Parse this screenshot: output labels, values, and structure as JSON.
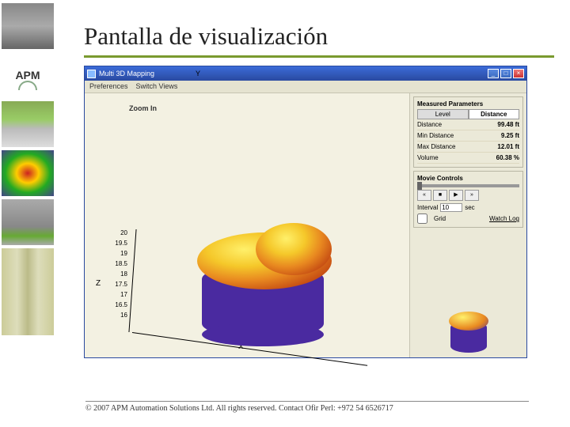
{
  "slide": {
    "title": "Pantalla de visualización",
    "footer": "© 2007 APM Automation Solutions Ltd. All rights reserved. Contact Ofir Perl: +972 54 6526717",
    "logo_text": "APM"
  },
  "app": {
    "window_title": "Multi 3D Mapping",
    "menu": [
      "Preferences",
      "Switch Views"
    ],
    "win_buttons": {
      "minimize": "_",
      "maximize": "□",
      "close": "×"
    },
    "zoom_label": "Zoom In"
  },
  "chart_data": {
    "type": "surface-3d",
    "z_ticks": [
      "20",
      "19.5",
      "19",
      "18.5",
      "18",
      "17.5",
      "17",
      "16.5",
      "16"
    ],
    "x_label": "X",
    "y_label": "Y",
    "z_label": "Z",
    "zlim": [
      16,
      20
    ],
    "description": "3D surface map of material level inside cylindrical bin; dome-shaped pile rendered with heat colormap over purple vessel"
  },
  "panel": {
    "measured_title": "Measured Parameters",
    "tabs": {
      "level": "Level",
      "distance": "Distance"
    },
    "active_tab": "distance",
    "rows": [
      {
        "label": "Distance",
        "value": "99.48 ft"
      },
      {
        "label": "Min Distance",
        "value": "9.25 ft"
      },
      {
        "label": "Max Distance",
        "value": "12.01 ft"
      },
      {
        "label": "Volume",
        "value": "60.38 %"
      }
    ],
    "movie_title": "Movie Controls",
    "interval_label": "Interval",
    "interval_value": "10",
    "interval_unit": "sec",
    "grid_label": "Grid",
    "watchlog_label": "Watch Log"
  }
}
